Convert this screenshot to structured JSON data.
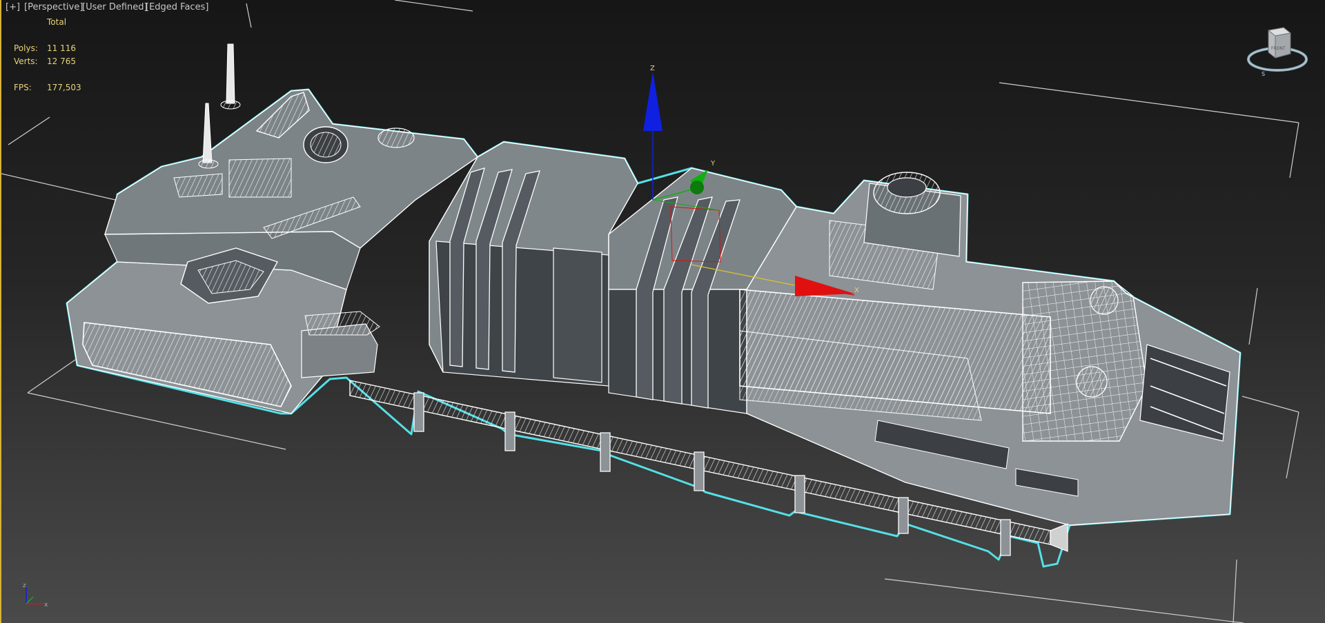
{
  "viewport": {
    "labels": {
      "plus": "[+]",
      "view": "[Perspective]",
      "shading": "[User Defined]",
      "edged": "[Edged Faces]"
    },
    "stats": {
      "total_label": "Total",
      "polys_label": "Polys:",
      "polys_value": "11 116",
      "verts_label": "Verts:",
      "verts_value": "12 765",
      "fps_label": "FPS:",
      "fps_value": "177,503"
    },
    "colors": {
      "background_top": "#161616",
      "background_bottom": "#4a4a4a",
      "model_fill": "#8c9296",
      "model_dark": "#3c4044",
      "selection_outline": "#55e0e6",
      "wire": "#ffffff",
      "stats_text": "#e8d37a",
      "active_label": "#e6c34a",
      "gizmo_x": "#e01010",
      "gizmo_y": "#10b010",
      "gizmo_z": "#1020e0"
    },
    "gizmo": {
      "x_label": "X",
      "y_label": "Y",
      "z_label": "Z"
    },
    "tripod": {
      "x_label": "x",
      "z_label": "z"
    },
    "viewcube": {
      "face_label": "FRONT",
      "compass_letter": "S"
    }
  }
}
